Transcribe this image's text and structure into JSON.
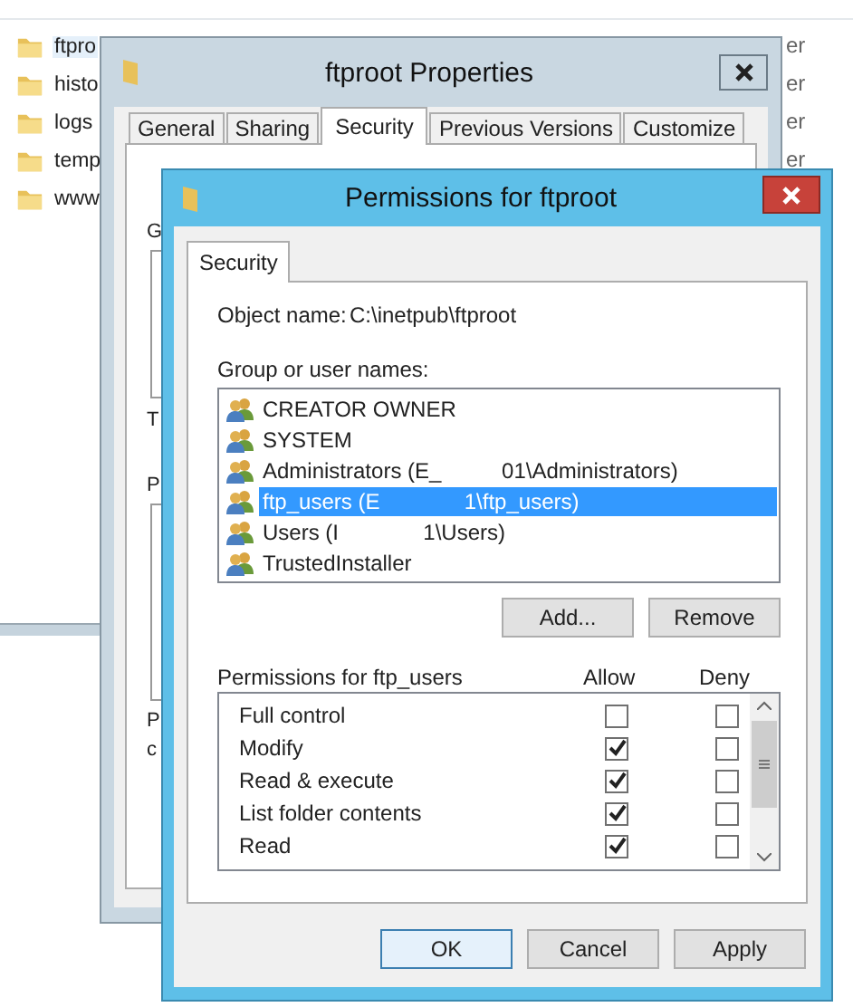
{
  "explorer": {
    "files": [
      {
        "name": "ftpro",
        "column_2": "er",
        "selected": true
      },
      {
        "name": "histo",
        "column_2": "er",
        "selected": false
      },
      {
        "name": "logs",
        "column_2": "er",
        "selected": false
      },
      {
        "name": "temp",
        "column_2": "er",
        "selected": false
      },
      {
        "name": "www",
        "selected": false
      }
    ]
  },
  "properties": {
    "title": "ftproot Properties",
    "tabs": [
      {
        "label": "General",
        "selected": false
      },
      {
        "label": "Sharing",
        "selected": false
      },
      {
        "label": "Security",
        "selected": true
      },
      {
        "label": "Previous Versions",
        "selected": false
      },
      {
        "label": "Customize",
        "selected": false
      }
    ],
    "covered_text": [
      "G",
      "T",
      "P",
      "P",
      "c"
    ]
  },
  "permissions": {
    "title": "Permissions for ftproot",
    "tabs": [
      {
        "label": "Security",
        "selected": true
      }
    ],
    "object_name_label": "Object name:",
    "object_name": "C:\\inetpub\\ftproot",
    "group_label": "Group or user names:",
    "users": [
      {
        "name": "CREATOR OWNER",
        "selected": false
      },
      {
        "name": "SYSTEM",
        "selected": false
      },
      {
        "name": "Administrators (E_          01\\Administrators)",
        "selected": false
      },
      {
        "name": "ftp_users (E              1\\ftp_users)",
        "selected": true
      },
      {
        "name": "Users (I              1\\Users)",
        "selected": false
      },
      {
        "name": "TrustedInstaller",
        "selected": false
      }
    ],
    "add_button": "Add...",
    "remove_button": "Remove",
    "permissions_label": "Permissions for ftp_users",
    "allow_header": "Allow",
    "deny_header": "Deny",
    "rows": [
      {
        "name": "Full control",
        "allow": false,
        "deny": false
      },
      {
        "name": "Modify",
        "allow": true,
        "deny": false
      },
      {
        "name": "Read & execute",
        "allow": true,
        "deny": false
      },
      {
        "name": "List folder contents",
        "allow": true,
        "deny": false
      },
      {
        "name": "Read",
        "allow": true,
        "deny": false
      }
    ],
    "buttons": [
      {
        "label": "OK",
        "default": true
      },
      {
        "label": "Cancel",
        "default": false
      },
      {
        "label": "Apply",
        "default": false
      }
    ]
  }
}
